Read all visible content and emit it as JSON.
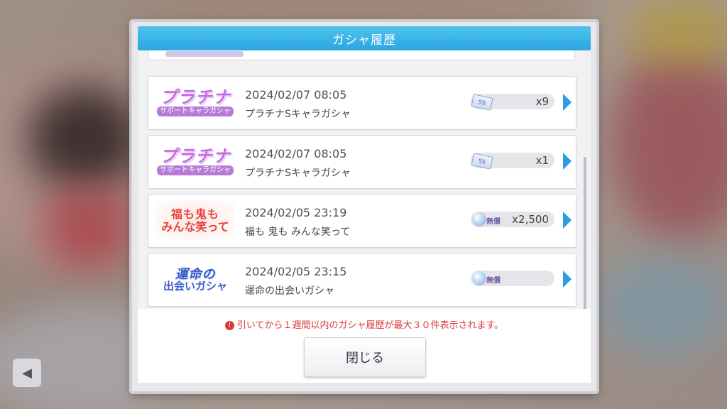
{
  "dialog": {
    "title": "ガシャ履歴",
    "accent_color": "#2aa6e0",
    "notice": "引いてから１週間以内のガシャ履歴が最大３０件表示されます。",
    "close_label": "閉じる"
  },
  "history": [
    {
      "logo_icon": "platinum-banner-icon",
      "logo_main": "プラチナ",
      "logo_sub": "サポートキャラガシャ",
      "datetime": "2024/02/07 08:05",
      "gacha_name": "プラチナSキャラガシャ",
      "cost_icon": "ticket-icon",
      "ticket_label": "SS",
      "cost": "x9"
    },
    {
      "logo_icon": "platinum-banner-icon",
      "logo_main": "プラチナ",
      "logo_sub": "サポートキャラガシャ",
      "datetime": "2024/02/07 08:05",
      "gacha_name": "プラチナSキャラガシャ",
      "cost_icon": "ticket-icon",
      "ticket_label": "SS",
      "cost": "x1"
    },
    {
      "logo_icon": "fuku-banner-icon",
      "logo_main": "福も鬼も",
      "logo_sub": "みんな笑って",
      "datetime": "2024/02/05 23:19",
      "gacha_name": "福も 鬼も みんな笑って",
      "cost_icon": "gem-icon",
      "free_label": "無償",
      "cost": "x2,500"
    },
    {
      "logo_icon": "unmei-banner-icon",
      "logo_main": "運命の",
      "logo_sub": "出会いガシャ",
      "datetime": "2024/02/05 23:15",
      "gacha_name": "運命の出会いガシャ",
      "cost_icon": "gem-icon",
      "free_label": "無償",
      "cost": ""
    }
  ]
}
